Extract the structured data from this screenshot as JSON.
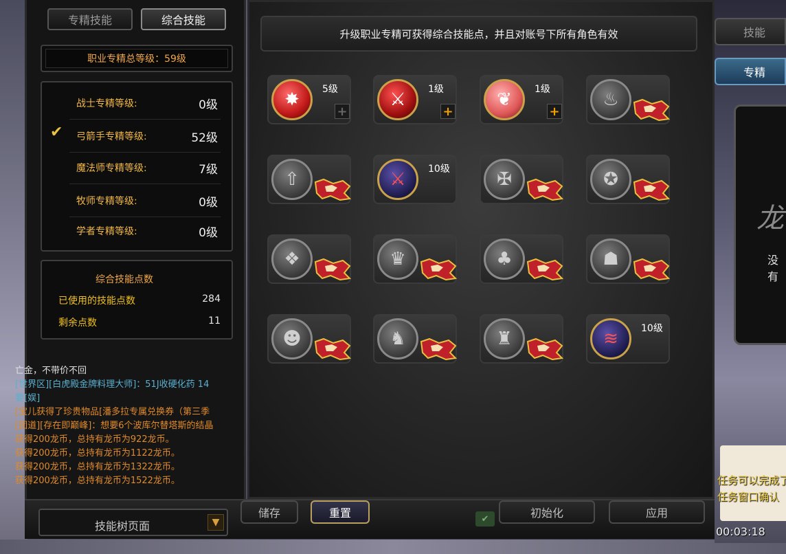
{
  "left_panel": {
    "tabs": [
      "专精技能",
      "综合技能"
    ],
    "total_level": "职业专精总等级：59级",
    "classes": [
      {
        "label": "战士专精等级:",
        "value": "0级"
      },
      {
        "label": "弓箭手专精等级:",
        "value": "52级"
      },
      {
        "label": "魔法师专精等级:",
        "value": "7级"
      },
      {
        "label": "牧师专精等级:",
        "value": "0级"
      },
      {
        "label": "学者专精等级:",
        "value": "0级"
      }
    ],
    "selected_check": "✔",
    "points": {
      "title": "综合技能点数",
      "used_label": "已使用的技能点数",
      "used_value": "284",
      "remaining_label": "剩余点数",
      "remaining_value": "11"
    }
  },
  "chat": [
    {
      "text": "亡金，不带价不回",
      "color": "#e0e0e0"
    },
    {
      "text": "[世界区][白虎殿金牌料理大师]：51J收硬化药  14",
      "color": "#5ab0d0"
    },
    {
      "text": "要[娱]",
      "color": "#5ab0d0"
    },
    {
      "text": "[宝儿获得了珍贵物品[潘多拉专属兑换券（第三季",
      "color": "#e08a2a"
    },
    {
      "text": "[团道][存在即巅峰]：想要6个波库尔替塔斯的结晶",
      "color": "#e08a2a"
    },
    {
      "text": "获得200龙币，总持有龙币为922龙币。",
      "color": "#e08a2a"
    },
    {
      "text": "获得200龙币，总持有龙币为1122龙币。",
      "color": "#e08a2a"
    },
    {
      "text": "获得200龙币，总持有龙币为1322龙币。",
      "color": "#e08a2a"
    },
    {
      "text": "获得200龙币，总持有龙币为1522龙币。",
      "color": "#e08a2a"
    }
  ],
  "main": {
    "banner": "升级职业专精可获得综合技能点，并且对账号下所有角色有效",
    "skills": [
      {
        "icon": "claw-burst-icon",
        "glyph": "✸",
        "style": "red",
        "level": "5级",
        "plus": "disabled",
        "locked": false
      },
      {
        "icon": "sword-strike-icon",
        "glyph": "⚔",
        "style": "sword",
        "level": "1级",
        "plus": "enabled",
        "locked": false
      },
      {
        "icon": "feather-icon",
        "glyph": "❦",
        "style": "feather",
        "level": "1级",
        "plus": "enabled",
        "locked": false
      },
      {
        "icon": "flame-icon",
        "glyph": "♨",
        "style": "gray",
        "level": "",
        "plus": "none",
        "locked": true
      },
      {
        "icon": "flame-up-icon",
        "glyph": "⇧",
        "style": "gray",
        "level": "",
        "plus": "none",
        "locked": true
      },
      {
        "icon": "magic-sword-icon",
        "glyph": "⚔",
        "style": "dark",
        "level": "10级",
        "plus": "none",
        "locked": false
      },
      {
        "icon": "winged-shield-icon",
        "glyph": "✠",
        "style": "gray",
        "level": "",
        "plus": "none",
        "locked": true
      },
      {
        "icon": "shield-gear-icon",
        "glyph": "✪",
        "style": "gray",
        "level": "",
        "plus": "none",
        "locked": true
      },
      {
        "icon": "shield-wings-icon",
        "glyph": "❖",
        "style": "gray",
        "level": "",
        "plus": "none",
        "locked": true
      },
      {
        "icon": "crown-icon",
        "glyph": "♛",
        "style": "gray",
        "level": "",
        "plus": "none",
        "locked": true
      },
      {
        "icon": "leaf-shield-icon",
        "glyph": "♣",
        "style": "gray",
        "level": "",
        "plus": "none",
        "locked": true
      },
      {
        "icon": "ghost-icon",
        "glyph": "☗",
        "style": "gray",
        "level": "",
        "plus": "none",
        "locked": true
      },
      {
        "icon": "warrior-icon",
        "glyph": "☻",
        "style": "gray",
        "level": "",
        "plus": "none",
        "locked": true
      },
      {
        "icon": "runner-icon",
        "glyph": "♞",
        "style": "gray",
        "level": "",
        "plus": "none",
        "locked": true
      },
      {
        "icon": "statue-icon",
        "glyph": "♜",
        "style": "gray",
        "level": "",
        "plus": "none",
        "locked": true
      },
      {
        "icon": "claw-slash-icon",
        "glyph": "≋",
        "style": "dark",
        "level": "10级",
        "plus": "none",
        "locked": false
      }
    ]
  },
  "bottom": {
    "dropdown": "技能树页面",
    "save": "储存",
    "reset": "重置",
    "init": "初始化",
    "apply": "应用"
  },
  "right": {
    "tab_skill": "技能",
    "tab_spec": "专精",
    "logo": "龙",
    "frame_text": "没有",
    "notice1": "任务可以完成了",
    "notice2": "任务窗口确认",
    "time": "00:03:18"
  }
}
